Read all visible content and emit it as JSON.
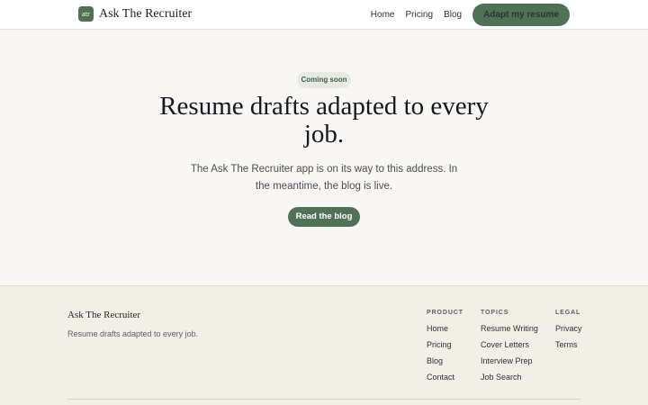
{
  "header": {
    "logo_badge": "atr",
    "brand": "Ask The Recruiter",
    "nav": [
      "Home",
      "Pricing",
      "Blog"
    ],
    "cta": "Adapt my resume"
  },
  "hero": {
    "badge": "Coming soon",
    "title": "Resume drafts adapted to every job.",
    "subtitle": "The Ask The Recruiter app is on its way to this address. In the meantime, the blog is live.",
    "button": "Read the blog"
  },
  "footer": {
    "brand": "Ask The Recruiter",
    "tagline": "Resume drafts adapted to every job.",
    "columns": [
      {
        "heading": "PRODUCT",
        "links": [
          "Home",
          "Pricing",
          "Blog",
          "Contact"
        ]
      },
      {
        "heading": "TOPICS",
        "links": [
          "Resume Writing",
          "Cover Letters",
          "Interview Prep",
          "Job Search"
        ]
      },
      {
        "heading": "LEGAL",
        "links": [
          "Privacy",
          "Terms"
        ]
      }
    ]
  },
  "colors": {
    "accent": "#4f7257",
    "page_bg": "#f8f7f3",
    "footer_bg": "#f2efe7",
    "badge_bg": "#e6ebe2"
  }
}
